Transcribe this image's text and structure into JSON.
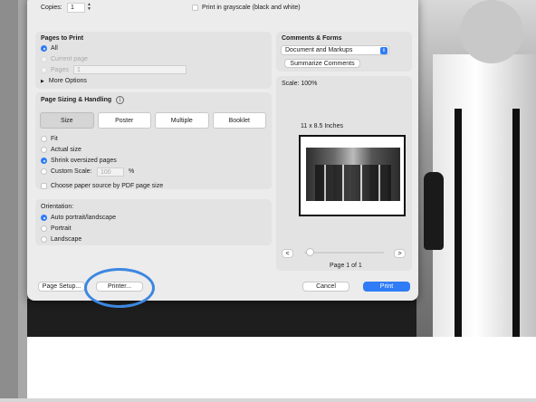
{
  "dialog": {
    "copies": {
      "label": "Copies:",
      "value": "1"
    },
    "grayscale_label": "Print in grayscale (black and white)",
    "pages_to_print": {
      "title": "Pages to Print",
      "all": "All",
      "current_page": "Current page",
      "pages": "Pages",
      "pages_value": "1",
      "more_options": "More Options"
    },
    "page_sizing": {
      "title": "Page Sizing & Handling",
      "tabs": [
        "Size",
        "Poster",
        "Multiple",
        "Booklet"
      ],
      "active_tab": "Size",
      "fit": "Fit",
      "actual_size": "Actual size",
      "shrink": "Shrink oversized pages",
      "custom_scale": "Custom Scale:",
      "custom_scale_value": "100",
      "percent": "%",
      "paper_source": "Choose paper source by PDF page size"
    },
    "orientation": {
      "title": "Orientation:",
      "auto": "Auto portrait/landscape",
      "portrait": "Portrait",
      "landscape": "Landscape"
    },
    "comments_forms": {
      "title": "Comments & Forms",
      "selected": "Document and Markups",
      "summarize": "Summarize Comments"
    },
    "preview": {
      "scale": "Scale: 100%",
      "paper_size": "11 x 8.5 Inches",
      "prev": "<",
      "next": ">",
      "page_info": "Page 1 of 1"
    },
    "buttons": {
      "page_setup": "Page Setup...",
      "printer": "Printer...",
      "cancel": "Cancel",
      "print": "Print"
    }
  },
  "colors": {
    "accent": "#2f7cf6",
    "highlight_ring": "#3d87e0"
  }
}
